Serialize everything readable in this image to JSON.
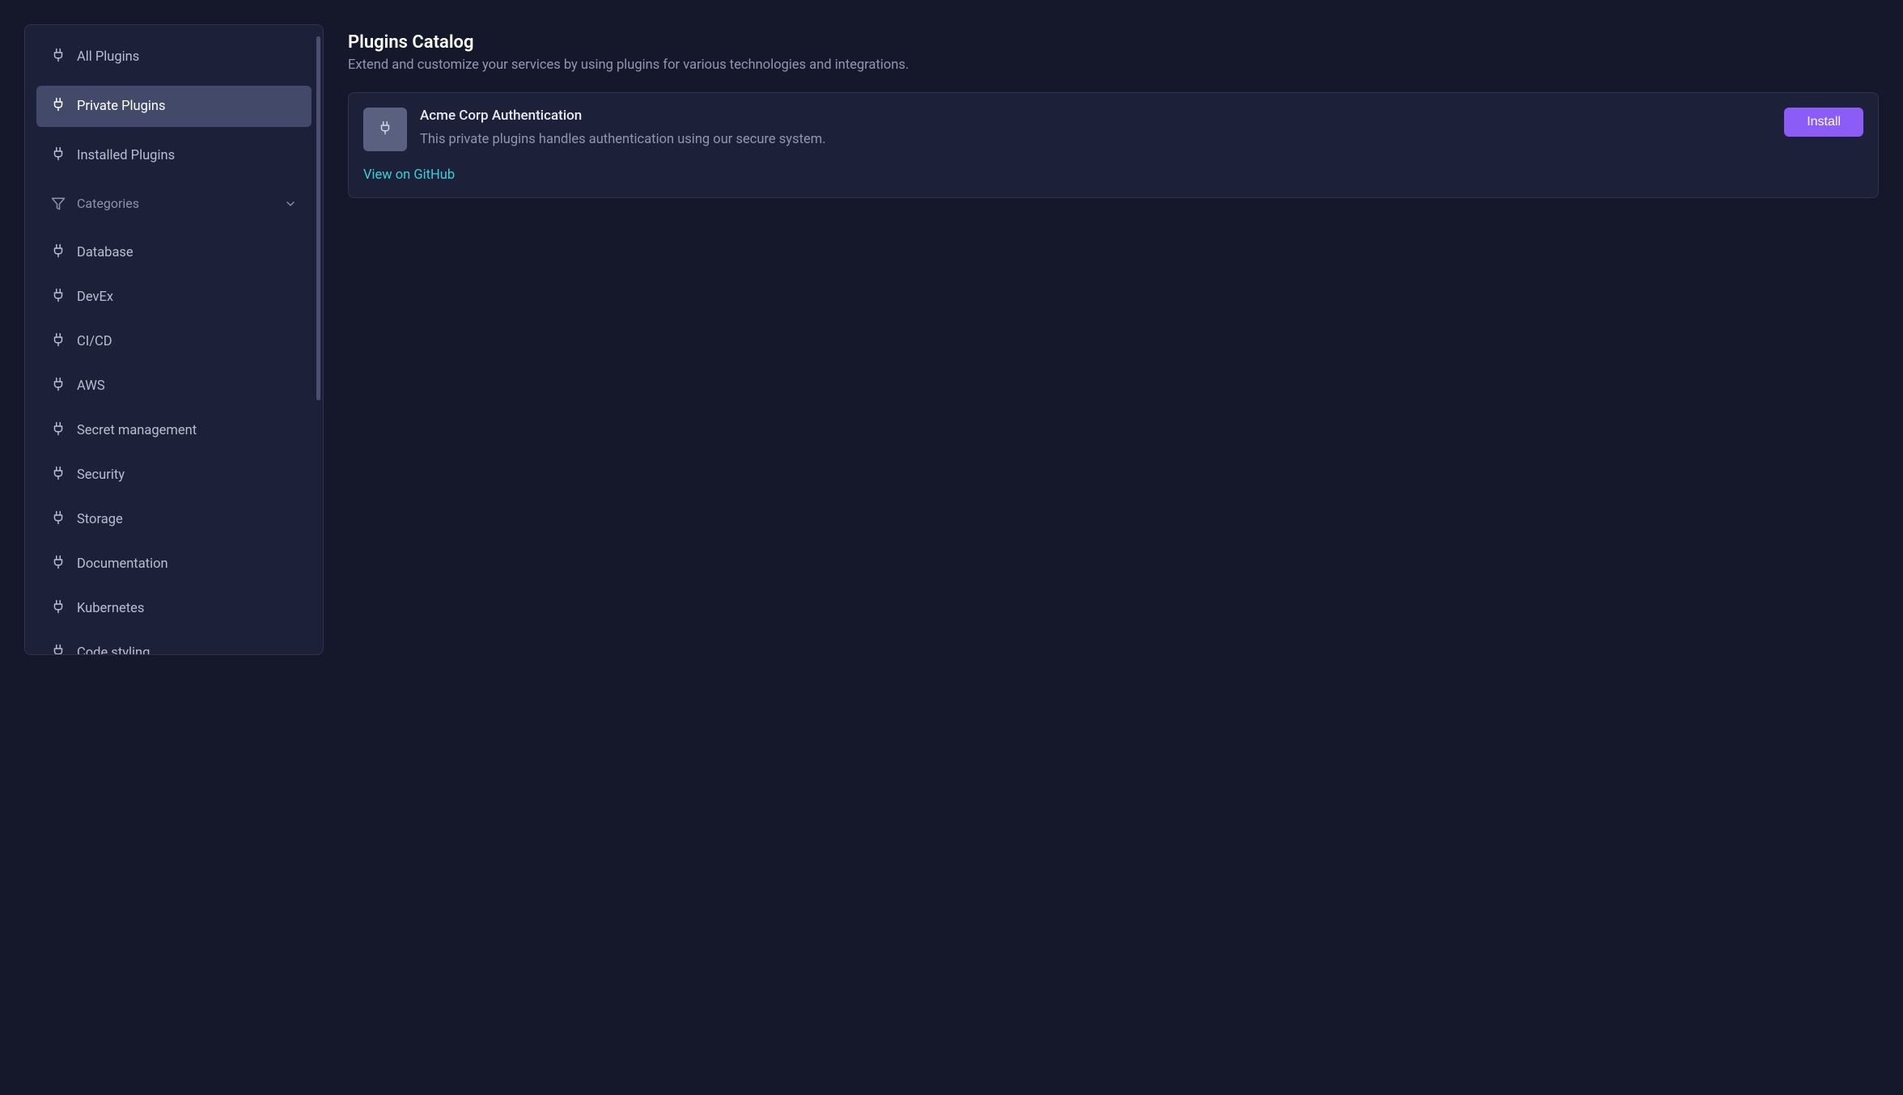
{
  "sidebar": {
    "nav_items": [
      {
        "label": "All Plugins",
        "active": false
      },
      {
        "label": "Private Plugins",
        "active": true
      },
      {
        "label": "Installed Plugins",
        "active": false
      }
    ],
    "categories_label": "Categories",
    "categories": [
      {
        "label": "Database"
      },
      {
        "label": "DevEx"
      },
      {
        "label": "CI/CD"
      },
      {
        "label": "AWS"
      },
      {
        "label": "Secret management"
      },
      {
        "label": "Security"
      },
      {
        "label": "Storage"
      },
      {
        "label": "Documentation"
      },
      {
        "label": "Kubernetes"
      },
      {
        "label": "Code styling"
      }
    ]
  },
  "main": {
    "title": "Plugins Catalog",
    "subtitle": "Extend and customize your services by using plugins for various technologies and integrations.",
    "plugin": {
      "name": "Acme Corp Authentication",
      "description": "This private plugins handles authentication using our secure system.",
      "install_label": "Install",
      "github_label": "View on GitHub"
    }
  }
}
